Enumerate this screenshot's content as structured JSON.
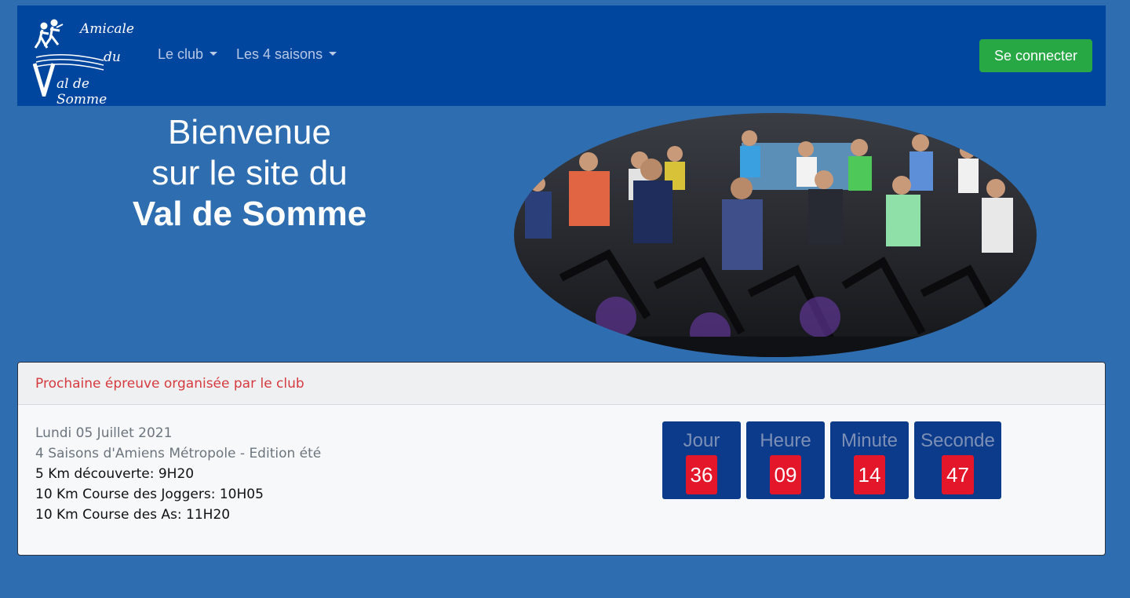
{
  "navbar": {
    "logo": {
      "line1": "Amicale",
      "line2": "du",
      "line3": "al de Somme"
    },
    "menu": [
      {
        "label": "Le club"
      },
      {
        "label": "Les 4 saisons"
      }
    ],
    "login_label": "Se connecter",
    "colors": {
      "background": "#00469e",
      "login_button": "#28a745"
    }
  },
  "welcome": {
    "line1": "Bienvenue",
    "line2": "sur le site du",
    "line3": "Val de Somme"
  },
  "hero_image": {
    "description_icon": "spinning-class-photo"
  },
  "next_event": {
    "header": "Prochaine épreuve organisée par le club",
    "date": "Lundi 05 Juillet 2021",
    "name": "4 Saisons d'Amiens Métropole - Edition été",
    "races": [
      "5 Km découverte: 9H20",
      "10 Km Course des Joggers: 10H05",
      "10 Km Course des As: 11H20"
    ],
    "countdown": [
      {
        "label": "Jour",
        "value": "36"
      },
      {
        "label": "Heure",
        "value": "09"
      },
      {
        "label": "Minute",
        "value": "14"
      },
      {
        "label": "Seconde",
        "value": "47"
      }
    ]
  },
  "colors": {
    "page_background": "#2f6db1",
    "countdown_box": "#0d3b8c",
    "countdown_value": "#e3162a",
    "header_text": "#d63a3f"
  }
}
